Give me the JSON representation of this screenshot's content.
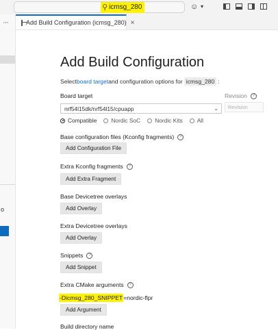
{
  "titlebar": {
    "search_text": "icmsg_280"
  },
  "tab": {
    "label": "Add Build Configuration (icmsg_280)",
    "close": "×"
  },
  "leftstrip": {
    "more": "···",
    "o_text": "o"
  },
  "main": {
    "title": "Add Build Configuration",
    "intro_prefix": "Select ",
    "intro_link": "board target",
    "intro_mid": " and configuration options for ",
    "intro_app": "icmsg_280",
    "intro_suffix": ":",
    "board_target_label": "Board target",
    "revision_label": "Revision",
    "board_target_value": "nrf54l15dk/nrf54l15/cpuapp",
    "revision_placeholder": "Revision",
    "radios": [
      {
        "label": "Compatible",
        "checked": true
      },
      {
        "label": "Nordic SoC",
        "checked": false
      },
      {
        "label": "Nordic Kits",
        "checked": false
      },
      {
        "label": "All",
        "checked": false
      }
    ],
    "base_config_label": "Base configuration files (Kconfig fragments)",
    "add_config_button": "Add Configuration File",
    "extra_kconfig_label": "Extra Kconfig fragments",
    "add_extra_fragment_button": "Add Extra Fragment",
    "base_devicetree_label": "Base Devicetree overlays",
    "add_overlay_button_1": "Add Overlay",
    "extra_devicetree_label": "Extra Devicetree overlays",
    "add_overlay_button_2": "Add Overlay",
    "snippets_label": "Snippets",
    "add_snippet_button": "Add Snippet",
    "extra_cmake_label": "Extra CMake arguments",
    "cmake_arg_highlighted": "-Dicmsg_280_SNIPPET",
    "cmake_arg_rest": "=nordic-flpr",
    "add_argument_button": "Add Argument",
    "build_dir_label": "Build directory name"
  },
  "colors": {
    "accent": "#0f6cbd",
    "highlight": "#fff200"
  }
}
